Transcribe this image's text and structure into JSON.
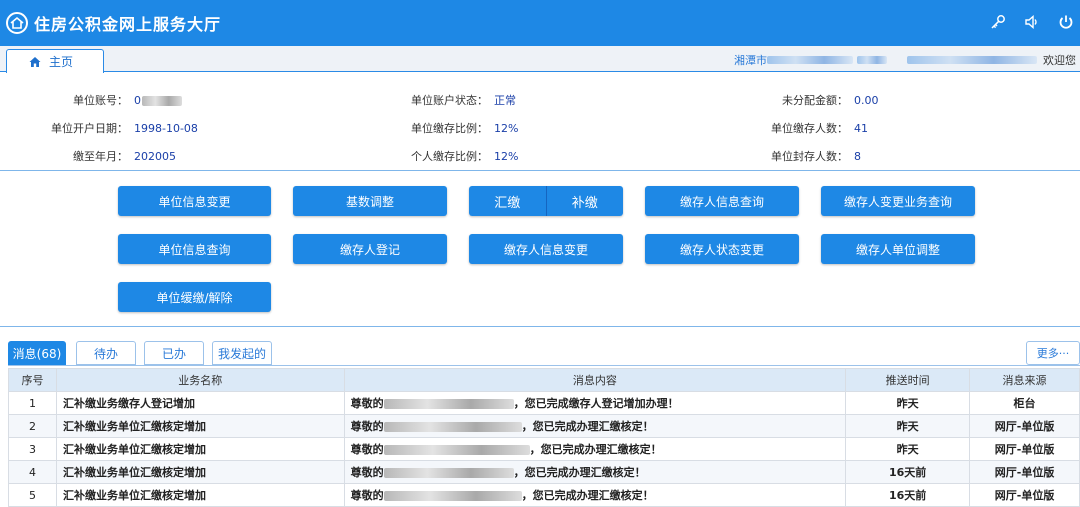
{
  "app": {
    "title": "住房公积金网上服务大厅"
  },
  "header_icons": [
    "key-icon",
    "speaker-icon",
    "power-icon"
  ],
  "tabs": {
    "home": "主页"
  },
  "user": {
    "city": "湘潭市",
    "welcome": "欢迎您"
  },
  "info": {
    "account_label": "单位账号：",
    "account_value": "0",
    "status_label": "单位账户状态：",
    "status_value": "正常",
    "unallocated_label": "未分配金额：",
    "unallocated_value": "0.00",
    "open_date_label": "单位开户日期：",
    "open_date_value": "1998-10-08",
    "unit_ratio_label": "单位缴存比例：",
    "unit_ratio_value": "12%",
    "depositors_label": "单位缴存人数：",
    "depositors_value": "41",
    "paid_to_label": "缴至年月：",
    "paid_to_value": "202005",
    "personal_ratio_label": "个人缴存比例：",
    "personal_ratio_value": "12%",
    "sealed_label": "单位封存人数：",
    "sealed_value": "8"
  },
  "actions": {
    "unit_info_change": "单位信息变更",
    "base_adjust": "基数调整",
    "remit": "汇缴",
    "supplement": "补缴",
    "depositor_info_query": "缴存人信息查询",
    "depositor_change_query": "缴存人变更业务查询",
    "unit_info_query": "单位信息查询",
    "depositor_register": "缴存人登记",
    "depositor_info_change": "缴存人信息变更",
    "depositor_status_change": "缴存人状态变更",
    "depositor_unit_adjust": "缴存人单位调整",
    "unit_defer": "单位缓缴/解除"
  },
  "messages": {
    "tabs": [
      "消息(68)",
      "待办",
      "已办",
      "我发起的"
    ],
    "more": "更多···",
    "headers": [
      "序号",
      "业务名称",
      "消息内容",
      "推送时间",
      "消息来源"
    ],
    "rows": [
      {
        "no": "1",
        "name": "汇补缴业务缴存人登记增加",
        "content_prefix": "尊敬的",
        "content_suffix": "，您已完成缴存人登记增加办理！",
        "time": "昨天",
        "source": "柜台"
      },
      {
        "no": "2",
        "name": "汇补缴业务单位汇缴核定增加",
        "content_prefix": "尊敬的",
        "content_suffix": "，您已完成办理汇缴核定！",
        "time": "昨天",
        "source": "网厅-单位版"
      },
      {
        "no": "3",
        "name": "汇补缴业务单位汇缴核定增加",
        "content_prefix": "尊敬的",
        "content_suffix": "，您已完成办理汇缴核定！",
        "time": "昨天",
        "source": "网厅-单位版"
      },
      {
        "no": "4",
        "name": "汇补缴业务单位汇缴核定增加",
        "content_prefix": "尊敬的",
        "content_suffix": "，您已完成办理汇缴核定！",
        "time": "16天前",
        "source": "网厅-单位版"
      },
      {
        "no": "5",
        "name": "汇补缴业务单位汇缴核定增加",
        "content_prefix": "尊敬的",
        "content_suffix": "，您已完成办理汇缴核定！",
        "time": "16天前",
        "source": "网厅-单位版"
      }
    ]
  },
  "colors": {
    "primary": "#1e88e5",
    "value_text": "#1a3fa8"
  }
}
